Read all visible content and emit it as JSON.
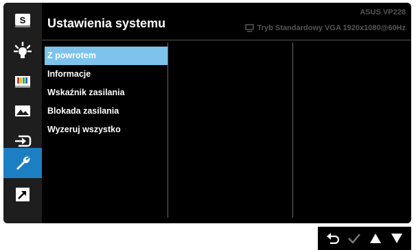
{
  "header": {
    "title": "Ustawienia systemu",
    "model": "ASUS  VP228",
    "mode_line": "Tryb Standardowy  VGA  1920x1080@60Hz"
  },
  "sidebar": {
    "items": [
      {
        "name": "splendid",
        "icon": "s-letter-icon",
        "label": "S"
      },
      {
        "name": "blue-light-filter",
        "icon": "light-bulb-icon"
      },
      {
        "name": "color",
        "icon": "color-bars-icon"
      },
      {
        "name": "image",
        "icon": "landscape-image-icon"
      },
      {
        "name": "input-select",
        "icon": "input-arrow-icon"
      },
      {
        "name": "system-setup",
        "icon": "wrench-icon",
        "active": true
      },
      {
        "name": "shortcut",
        "icon": "shortcut-arrow-icon"
      }
    ],
    "active_color": "#1c7fc3"
  },
  "menu": {
    "items": [
      {
        "label": "Z powrotem",
        "selected": true
      },
      {
        "label": "Informacje"
      },
      {
        "label": "Wskaźnik zasilania"
      },
      {
        "label": "Blokada zasilania"
      },
      {
        "label": "Wyzeruj wszystko"
      }
    ],
    "selected_color": "#7dc3ec"
  },
  "keys": [
    {
      "name": "back",
      "icon": "back-arrow-icon"
    },
    {
      "name": "confirm",
      "icon": "checkmark-icon"
    },
    {
      "name": "up",
      "icon": "up-triangle-icon"
    },
    {
      "name": "down",
      "icon": "down-triangle-icon"
    }
  ]
}
